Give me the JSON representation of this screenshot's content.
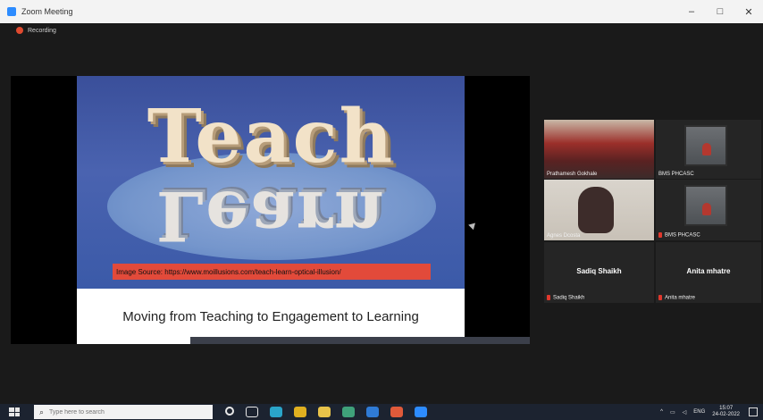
{
  "window": {
    "title": "Zoom Meeting",
    "controls": [
      "–",
      "□",
      "✕"
    ]
  },
  "recording": {
    "label": "Recording"
  },
  "shared_slide": {
    "word_top": "Teach",
    "word_bottom": "Learn",
    "source": "Image Source: https://www.moillusions.com/teach-learn-optical-illusion/",
    "caption": "Moving from Teaching to Engagement to Learning"
  },
  "participants": [
    {
      "label": "Prathamesh Gokhale",
      "type": "video-crowd"
    },
    {
      "label": "BMS PHCASC",
      "type": "video-room"
    },
    {
      "label": "Agnes Dcosta",
      "type": "video-face",
      "active": true
    },
    {
      "label": "BMS PHCASC",
      "type": "video-room",
      "muted": true
    },
    {
      "display_name": "Sadiq Shaikh",
      "label": "Sadiq Shaikh",
      "muted": true
    },
    {
      "display_name": "Anita mhatre",
      "label": "Anita mhatre",
      "muted": true
    }
  ],
  "taskbar": {
    "search_placeholder": "Type here to search",
    "apps": [
      {
        "name": "circle-icon",
        "color": "#e8e8e8"
      },
      {
        "name": "task-view-icon",
        "color": "#e8e8e8"
      },
      {
        "name": "edge-icon",
        "color": "#2aa5c9"
      },
      {
        "name": "chrome-icon",
        "color": "#e0b020"
      },
      {
        "name": "file-explorer-icon",
        "color": "#e8c34a"
      },
      {
        "name": "app-icon-1",
        "color": "#3fa17a"
      },
      {
        "name": "app-icon-2",
        "color": "#2f7bd6"
      },
      {
        "name": "app-icon-3",
        "color": "#e05a3a"
      },
      {
        "name": "zoom-icon",
        "color": "#2d8cff"
      }
    ],
    "tray": {
      "language": "ENG",
      "time": "15:07",
      "date": "24-02-2022"
    }
  },
  "colors": {
    "title_bar": "#f3f3f3",
    "meeting_bg": "#1a1a1a",
    "taskbar_bg": "#1c2330",
    "active_speaker_border": "#c9e86b",
    "recording_dot": "#e04a2f"
  }
}
